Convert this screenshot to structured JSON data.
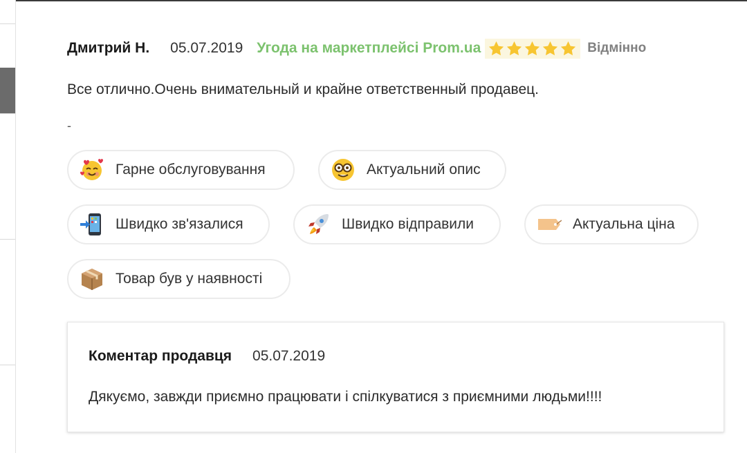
{
  "review": {
    "author": "Дмитрий Н.",
    "date": "05.07.2019",
    "marketplace": "Угода на маркетплейсі Prom.ua",
    "rating": 5,
    "rating_max": 5,
    "rating_label": "Відмінно",
    "text": "Все отлично.Очень внимательный и крайне ответственный продавец.",
    "extra": "-"
  },
  "tags": [
    {
      "label": "Гарне обслуговування",
      "icon": "smiling-face-with-hearts-icon"
    },
    {
      "label": "Актуальний опис",
      "icon": "nerd-face-icon"
    },
    {
      "label": "Швидко зв'язалися",
      "icon": "mobile-phone-with-arrow-icon"
    },
    {
      "label": "Швидко відправили",
      "icon": "rocket-icon"
    },
    {
      "label": "Актуальна ціна",
      "icon": "price-tag-icon"
    },
    {
      "label": "Товар був у наявності",
      "icon": "package-icon"
    }
  ],
  "seller_comment": {
    "title": "Коментар продавця",
    "date": "05.07.2019",
    "text": "Дякуємо, завжди приємно працювати і спілкуватися з приємними людьми!!!!"
  },
  "colors": {
    "marketplace_green": "#7cc26e",
    "star": "#f7c531",
    "stars_bg": "#fbf6df"
  }
}
